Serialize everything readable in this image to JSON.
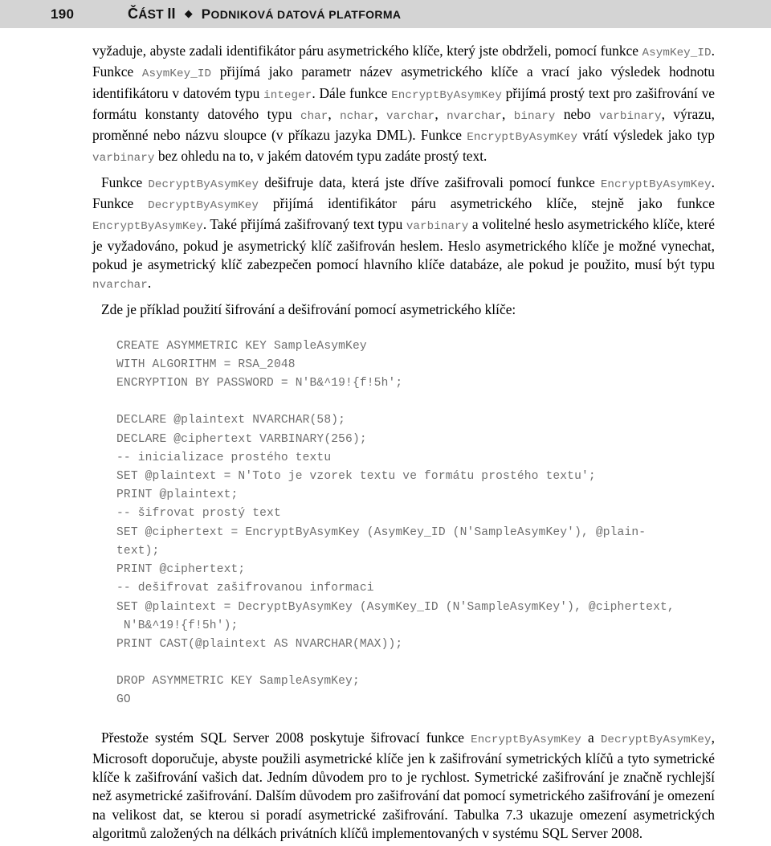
{
  "header": {
    "folio": "190",
    "part_label": "Část II",
    "separator_icon": "diamond-icon",
    "chapter_title": "Podniková datová platforma"
  },
  "body": {
    "paragraphs": [
      {
        "id": "p-asymkey-id",
        "indent": false,
        "runs": [
          {
            "t": "text",
            "v": "vyžaduje, abyste zadali identifikátor páru asymetrického klíče, který jste obdrželi, pomocí funkce "
          },
          {
            "t": "code",
            "v": "AsymKey_ID"
          },
          {
            "t": "text",
            "v": ". Funkce "
          },
          {
            "t": "code",
            "v": "AsymKey_ID"
          },
          {
            "t": "text",
            "v": " přijímá jako parametr název asymetrického klíče a vrací jako výsledek hodnotu identifikátoru v datovém typu "
          },
          {
            "t": "code",
            "v": "integer"
          },
          {
            "t": "text",
            "v": ". Dále funkce "
          },
          {
            "t": "code",
            "v": "EncryptByAsymKey"
          },
          {
            "t": "text",
            "v": " přijímá prostý text pro zašifrování ve formátu konstanty datového typu "
          },
          {
            "t": "code",
            "v": "char"
          },
          {
            "t": "text",
            "v": ", "
          },
          {
            "t": "code",
            "v": "nchar"
          },
          {
            "t": "text",
            "v": ", "
          },
          {
            "t": "code",
            "v": "varchar"
          },
          {
            "t": "text",
            "v": ", "
          },
          {
            "t": "code",
            "v": "nvarchar"
          },
          {
            "t": "text",
            "v": ", "
          },
          {
            "t": "code",
            "v": "binary"
          },
          {
            "t": "text",
            "v": " nebo "
          },
          {
            "t": "code",
            "v": "varbinary"
          },
          {
            "t": "text",
            "v": ", výrazu, proměnné nebo názvu sloupce (v příkazu jazyka DML). Funkce "
          },
          {
            "t": "code",
            "v": "EncryptByAsymKey"
          },
          {
            "t": "text",
            "v": " vrátí výsledek jako typ "
          },
          {
            "t": "code",
            "v": "varbinary"
          },
          {
            "t": "text",
            "v": " bez ohledu na to, v jakém datovém typu zadáte prostý text."
          }
        ]
      },
      {
        "id": "p-decrypt",
        "indent": true,
        "runs": [
          {
            "t": "text",
            "v": "Funkce "
          },
          {
            "t": "code",
            "v": "DecryptByAsymKey"
          },
          {
            "t": "text",
            "v": " dešifruje data, která jste dříve zašifrovali pomocí funkce "
          },
          {
            "t": "code",
            "v": "EncryptByAsymKey"
          },
          {
            "t": "text",
            "v": ". Funkce "
          },
          {
            "t": "code",
            "v": "DecryptByAsymKey"
          },
          {
            "t": "text",
            "v": " přijímá identifikátor páru asymetrického klíče, stejně jako funkce "
          },
          {
            "t": "code",
            "v": "EncryptByAsymKey"
          },
          {
            "t": "text",
            "v": ". Také přijímá zašifrovaný text typu "
          },
          {
            "t": "code",
            "v": "varbinary"
          },
          {
            "t": "text",
            "v": " a volitelné heslo asymetrického klíče, které je vyžadováno, pokud je asymetrický klíč zašifrován heslem. Heslo asymetrického klíče je možné vynechat, pokud je asymetrický klíč zabezpečen pomocí hlavního klíče databáze, ale pokud je použito, musí být typu "
          },
          {
            "t": "code",
            "v": "nvarchar"
          },
          {
            "t": "text",
            "v": "."
          }
        ]
      },
      {
        "id": "p-example-intro",
        "indent": true,
        "runs": [
          {
            "t": "text",
            "v": "Zde je příklad použití šifrování a dešifrování pomocí asymetrického klíče:"
          }
        ]
      }
    ],
    "code_blocks": [
      {
        "id": "code-create-key",
        "lines": [
          "CREATE ASYMMETRIC KEY SampleAsymKey",
          "WITH ALGORITHM = RSA_2048",
          "ENCRYPTION BY PASSWORD = N'B&^19!{f!5h';"
        ]
      },
      {
        "id": "code-encrypt-decrypt",
        "lines": [
          "DECLARE @plaintext NVARCHAR(58);",
          "DECLARE @ciphertext VARBINARY(256);",
          "-- inicializace prostého textu",
          "SET @plaintext = N'Toto je vzorek textu ve formátu prostého textu';",
          "PRINT @plaintext;",
          "-- šifrovat prostý text",
          "SET @ciphertext = EncryptByAsymKey (AsymKey_ID (N'SampleAsymKey'), @plain-",
          "text);",
          "PRINT @ciphertext;",
          "-- dešifrovat zašifrovanou informaci",
          "SET @plaintext = DecryptByAsymKey (AsymKey_ID (N'SampleAsymKey'), @ciphertext,",
          " N'B&^19!{f!5h');",
          "PRINT CAST(@plaintext AS NVARCHAR(MAX));"
        ]
      },
      {
        "id": "code-drop-key",
        "lines": [
          "DROP ASYMMETRIC KEY SampleAsymKey;",
          "GO"
        ]
      }
    ],
    "closing_paragraph": {
      "id": "p-closing",
      "indent": true,
      "runs": [
        {
          "t": "text",
          "v": "Přestože systém SQL Server 2008 poskytuje šifrovací funkce "
        },
        {
          "t": "code",
          "v": "EncryptByAsymKey"
        },
        {
          "t": "text",
          "v": " a "
        },
        {
          "t": "code",
          "v": "DecryptByAsymKey"
        },
        {
          "t": "text",
          "v": ", Microsoft doporučuje, abyste použili asymetrické klíče jen k zašifrování symetrických klíčů a tyto symetrické klíče k zašifrování vašich dat. Jedním důvodem pro to je rychlost. Symetrické zašifrování je značně rychlejší než asymetrické zašifrování. Dalším důvodem pro zašifrování dat pomocí symetrického zašifrování je omezení na velikost dat, se kterou si poradí asymetrické zašifrování. Tabulka 7.3 ukazuje omezení asymetrických algoritmů založených na délkách privátních klíčů implementovaných v systému SQL Server 2008."
        }
      ]
    }
  },
  "colors": {
    "header_band": "#d4d4d4",
    "code_text": "#6e6e6e",
    "body_text": "#000000",
    "page_background": "#ffffff"
  }
}
